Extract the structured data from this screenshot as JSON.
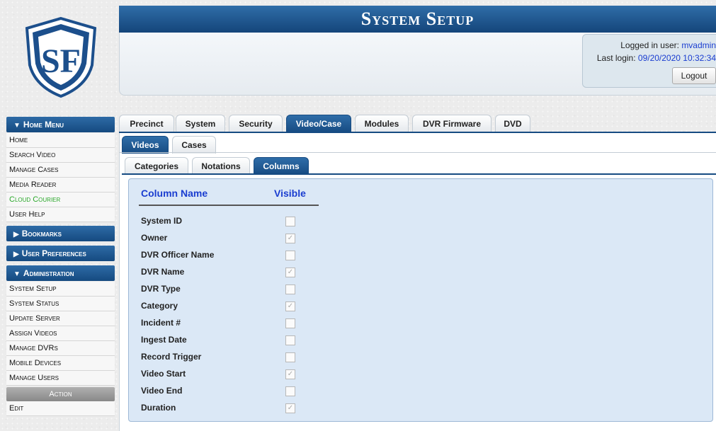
{
  "header": {
    "title": "System Setup",
    "logo_letters": "SF",
    "logged_in_label": "Logged in user:",
    "logged_in_user": "mvadmin",
    "last_login_label": "Last login:",
    "last_login_value": "09/20/2020 10:32:34",
    "logout_label": "Logout"
  },
  "sidebar": {
    "home_menu": {
      "label": "Home Menu",
      "items": [
        "Home",
        "Search Video",
        "Manage Cases",
        "Media Reader",
        "Cloud Courier",
        "User Help"
      ]
    },
    "bookmarks": "Bookmarks",
    "user_preferences": "User Preferences",
    "administration": {
      "label": "Administration",
      "items": [
        "System Setup",
        "System Status",
        "Update Server",
        "Assign Videos",
        "Manage DVRs",
        "Mobile Devices",
        "Manage Users"
      ]
    },
    "action": {
      "label": "Action",
      "items": [
        "Edit"
      ]
    }
  },
  "tabs": {
    "main": [
      "Precinct",
      "System",
      "Security",
      "Video/Case",
      "Modules",
      "DVR Firmware",
      "DVD"
    ],
    "main_active": "Video/Case",
    "sub": [
      "Videos",
      "Cases"
    ],
    "sub_active": "Videos",
    "sub2": [
      "Categories",
      "Notations",
      "Columns"
    ],
    "sub2_active": "Columns"
  },
  "columns_table": {
    "header_name": "Column Name",
    "header_visible": "Visible",
    "rows": [
      {
        "name": "System ID",
        "visible": false
      },
      {
        "name": "Owner",
        "visible": true
      },
      {
        "name": "DVR Officer Name",
        "visible": false
      },
      {
        "name": "DVR Name",
        "visible": true
      },
      {
        "name": "DVR Type",
        "visible": false
      },
      {
        "name": "Category",
        "visible": true
      },
      {
        "name": "Incident #",
        "visible": false
      },
      {
        "name": "Ingest Date",
        "visible": false
      },
      {
        "name": "Record Trigger",
        "visible": false
      },
      {
        "name": "Video Start",
        "visible": true
      },
      {
        "name": "Video End",
        "visible": false
      },
      {
        "name": "Duration",
        "visible": true
      }
    ]
  },
  "colors": {
    "header_blue": "#164b82",
    "link_blue": "#1a3dd0",
    "cloud_green": "#2aa82a",
    "panel_blue": "#dbe8f6"
  }
}
